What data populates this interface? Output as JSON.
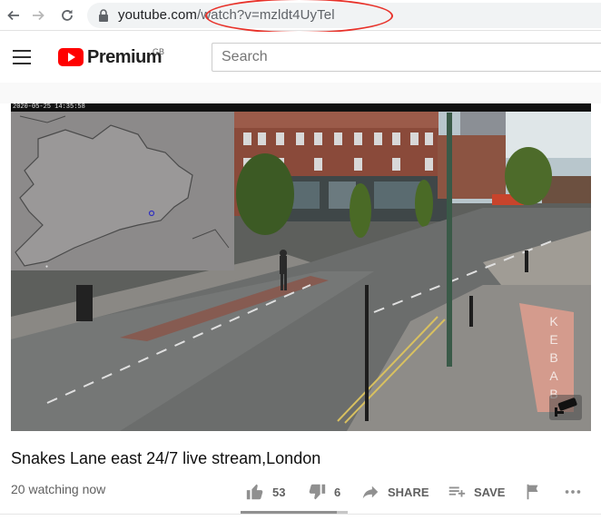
{
  "browser": {
    "url_domain": "youtube.com",
    "url_path": "/watch?v=mzldt4UyTel"
  },
  "header": {
    "logo_text": "Premium",
    "region": "GB",
    "search_placeholder": "Search"
  },
  "video": {
    "timestamp": "2020-05-25 14:35:58",
    "sign_text": "KEBAB"
  },
  "info": {
    "title": "Snakes Lane east 24/7 live stream,London",
    "watching": "20 watching now"
  },
  "actions": {
    "likes": "53",
    "dislikes": "6",
    "share_label": "SHARE",
    "save_label": "SAVE",
    "like_ratio": 0.9
  },
  "colors": {
    "brand": "#ff0000",
    "annotation": "#e8322a"
  }
}
